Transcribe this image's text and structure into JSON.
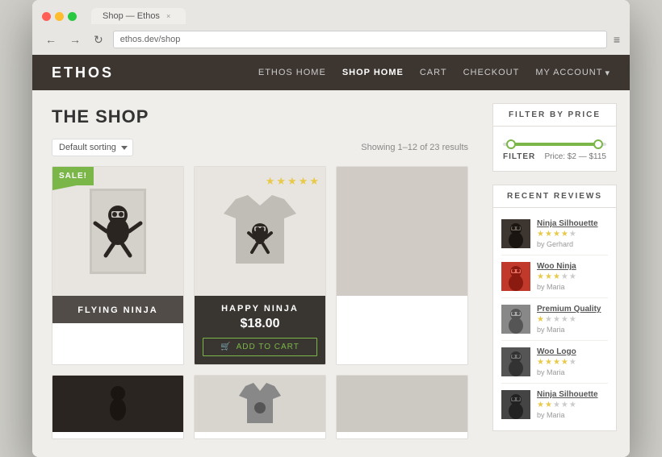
{
  "browser": {
    "tab_label": "Shop — Ethos",
    "tab_close": "×",
    "nav": {
      "back_icon": "←",
      "forward_icon": "→",
      "refresh_icon": "↻",
      "menu_icon": "≡"
    }
  },
  "site": {
    "logo": "ETHOS",
    "nav_items": [
      {
        "label": "ETHOS HOME",
        "active": false
      },
      {
        "label": "SHOP HOME",
        "active": true
      },
      {
        "label": "CART",
        "active": false
      },
      {
        "label": "CHECKOUT",
        "active": false
      },
      {
        "label": "MY ACCOUNT",
        "active": false,
        "dropdown": true
      }
    ]
  },
  "page": {
    "title": "THE SHOP"
  },
  "toolbar": {
    "sort_label": "Default sorting",
    "results_text": "Showing 1–12 of 23 results"
  },
  "products": [
    {
      "name": "FLYING NINJA",
      "sale": true,
      "price": null,
      "stars": 0,
      "type": "poster"
    },
    {
      "name": "HAPPY NINJA",
      "sale": false,
      "price": "$18.00",
      "stars": 5,
      "type": "tshirt",
      "add_to_cart": "ADD TO CART"
    },
    {
      "name": "",
      "sale": false,
      "price": null,
      "stars": 0,
      "type": "partial"
    }
  ],
  "bottom_products": [
    {
      "type": "ninja_dark"
    },
    {
      "type": "ninja_gray"
    },
    {
      "type": "partial"
    }
  ],
  "sidebar": {
    "filter_widget": {
      "title": "FILTER BY PRICE",
      "filter_btn": "FILTER",
      "price_range": "Price: $2 — $115"
    },
    "reviews_widget": {
      "title": "RECENT REVIEWS",
      "reviews": [
        {
          "product": "Ninja Silhouette",
          "stars": 4,
          "total_stars": 5,
          "author": "by Gerhard",
          "color": "#3d3530"
        },
        {
          "product": "Woo Ninja",
          "stars": 3,
          "total_stars": 5,
          "author": "by Maria",
          "color": "#c0392b"
        },
        {
          "product": "Premium Quality",
          "stars": 1,
          "total_stars": 5,
          "author": "by Maria",
          "color": "#888"
        },
        {
          "product": "Woo Logo",
          "stars": 4,
          "total_stars": 5,
          "author": "by Maria",
          "color": "#555"
        },
        {
          "product": "Ninja Silhouette",
          "stars": 2,
          "total_stars": 5,
          "author": "by Maria",
          "color": "#444"
        }
      ]
    }
  }
}
